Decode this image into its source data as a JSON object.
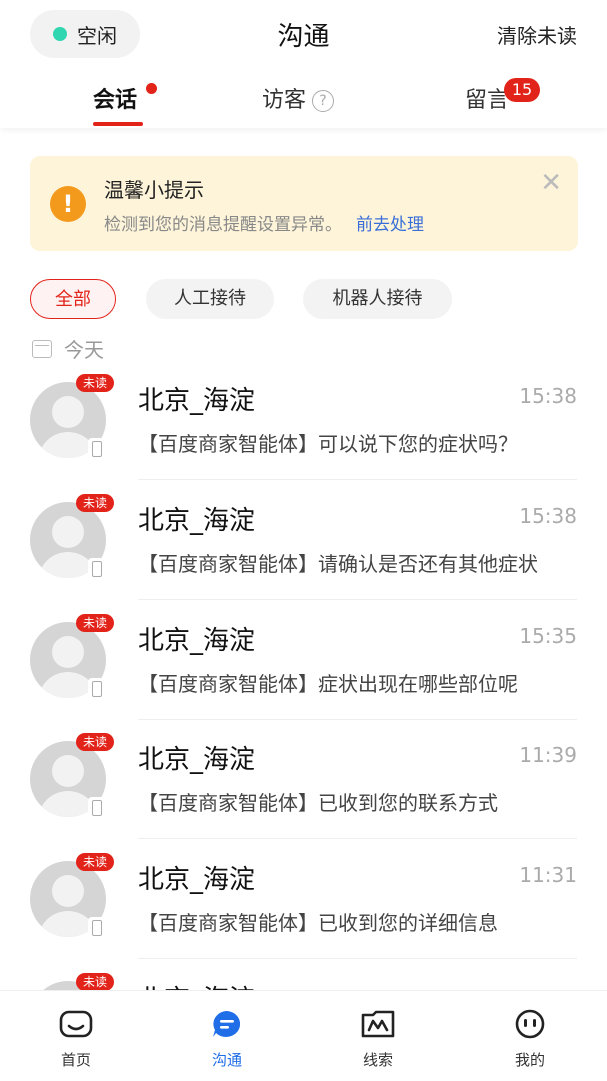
{
  "header": {
    "status": "空闲",
    "title": "沟通",
    "clear_unread": "清除未读"
  },
  "tabs": [
    {
      "label": "会话"
    },
    {
      "label": "访客"
    },
    {
      "label": "留言",
      "badge": "15"
    }
  ],
  "tip": {
    "icon": "!",
    "title": "温馨小提示",
    "text": "检测到您的消息提醒设置异常。",
    "link": "前去处理",
    "close": "✕"
  },
  "filters": [
    "全部",
    "人工接待",
    "机器人接待"
  ],
  "date_label": "今天",
  "conversations": [
    {
      "name": "北京_海淀",
      "time": "15:38",
      "message": "【百度商家智能体】可以说下您的症状吗？",
      "badge": "未读"
    },
    {
      "name": "北京_海淀",
      "time": "15:38",
      "message": "【百度商家智能体】请确认是否还有其他症状",
      "badge": "未读"
    },
    {
      "name": "北京_海淀",
      "time": "15:35",
      "message": "【百度商家智能体】症状出现在哪些部位呢",
      "badge": "未读"
    },
    {
      "name": "北京_海淀",
      "time": "11:39",
      "message": "【百度商家智能体】已收到您的联系方式",
      "badge": "未读"
    },
    {
      "name": "北京_海淀",
      "time": "11:31",
      "message": "【百度商家智能体】已收到您的详细信息",
      "badge": "未读"
    },
    {
      "name": "北京_海淀",
      "time": "",
      "message": "",
      "badge": "未读"
    }
  ],
  "nav": [
    {
      "label": "首页",
      "icon": "home-icon"
    },
    {
      "label": "沟通",
      "icon": "chat-icon"
    },
    {
      "label": "线索",
      "icon": "leads-icon"
    },
    {
      "label": "我的",
      "icon": "profile-icon"
    }
  ],
  "colors": {
    "accent": "#e2231a",
    "blue": "#1f6ee8",
    "tip_bg": "#fdf4d9",
    "status": "#2fd6b0"
  }
}
